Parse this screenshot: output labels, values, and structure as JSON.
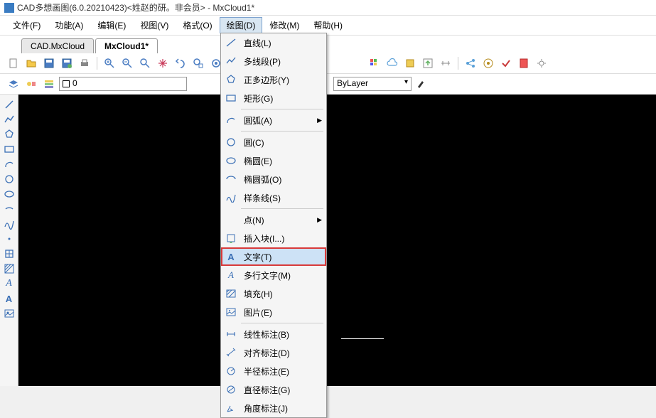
{
  "window": {
    "title": "CAD多想画图(6.0.20210423)<姓赵的研。非会员> - MxCloud1*"
  },
  "menu": {
    "file": "文件(F)",
    "function": "功能(A)",
    "edit": "编辑(E)",
    "view": "视图(V)",
    "format": "格式(O)",
    "draw": "绘图(D)",
    "modify": "修改(M)",
    "help": "帮助(H)"
  },
  "tabs": {
    "t1": "CAD.MxCloud",
    "t2": "MxCloud1*"
  },
  "layer": {
    "value": "0"
  },
  "props": {
    "bylayer": "ByLayer"
  },
  "dropdown": {
    "line": "直线(L)",
    "polyline": "多线段(P)",
    "polygon": "正多边形(Y)",
    "rectangle": "矩形(G)",
    "arc": "圆弧(A)",
    "circle": "圆(C)",
    "ellipse": "椭圆(E)",
    "ellipseArc": "椭圆弧(O)",
    "spline": "样条线(S)",
    "point": "点(N)",
    "insertBlock": "插入块(I...)",
    "text": "文字(T)",
    "mtext": "多行文字(M)",
    "hatch": "填充(H)",
    "image": "图片(E)",
    "linearDim": "线性标注(B)",
    "alignedDim": "对齐标注(D)",
    "radiusDim": "半径标注(E)",
    "diameterDim": "直径标注(G)",
    "angularDim": "角度标注(J)"
  }
}
